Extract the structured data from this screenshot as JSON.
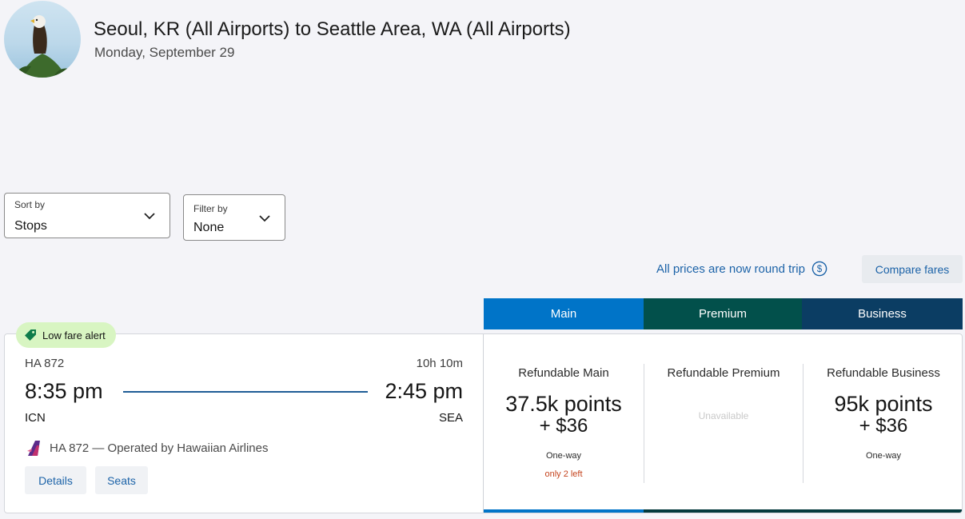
{
  "header": {
    "title": "Seoul, KR (All Airports) to Seattle Area, WA (All Airports)",
    "date": "Monday, September 29",
    "avatar_icon": "eagle-photo"
  },
  "controls": {
    "sort": {
      "label": "Sort by",
      "value": "Stops"
    },
    "filter": {
      "label": "Filter by",
      "value": "None"
    }
  },
  "notice": {
    "round_trip_text": "All prices are now round trip",
    "icon": "dollar-circle-icon"
  },
  "compare_label": "Compare fares",
  "tabs": [
    {
      "label": "Main",
      "color": "#0074c8"
    },
    {
      "label": "Premium",
      "color": "#02504b"
    },
    {
      "label": "Business",
      "color": "#0b3d63"
    }
  ],
  "flight": {
    "badge": "Low fare alert",
    "number": "HA 872",
    "duration": "10h 10m",
    "depart_time": "8:35 pm",
    "arrive_time": "2:45 pm",
    "depart_code": "ICN",
    "arrive_code": "SEA",
    "operator": "HA 872 — Operated by Hawaiian Airlines",
    "details_label": "Details",
    "seats_label": "Seats"
  },
  "fares": [
    {
      "name": "Refundable Main",
      "points": "37.5k points",
      "cash": "+ $36",
      "type": "One-way",
      "seats_left": "only 2 left"
    },
    {
      "name": "Refundable Premium",
      "unavailable": "Unavailable"
    },
    {
      "name": "Refundable Business",
      "points": "95k points",
      "cash": "+ $36",
      "type": "One-way"
    }
  ]
}
